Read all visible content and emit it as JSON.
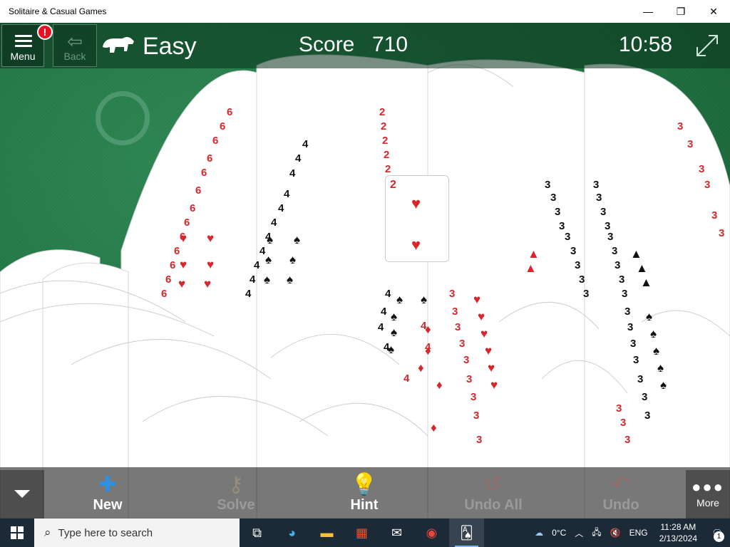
{
  "window": {
    "title": "Solitaire & Casual Games",
    "controls": {
      "minimize": "—",
      "maximize": "❐",
      "close": "✕"
    }
  },
  "game": {
    "menu_label": "Menu",
    "alert_badge": "!",
    "back_label": "Back",
    "back_icon": "arrow-left-icon",
    "difficulty_icon": "polar-bear-icon",
    "difficulty": "Easy",
    "score_label": "Score",
    "score_value": "710",
    "timer": "10:58",
    "fullscreen_icon": "expand-arrows-icon",
    "colors": {
      "felt": "#1f7040",
      "red_suit": "#d9262b",
      "black_suit": "#111111"
    }
  },
  "toolbar": {
    "expand_icon": "chevron-down-icon",
    "new_label": "New",
    "solve_label": "Solve",
    "hint_label": "Hint",
    "undo_all_label": "Undo All",
    "undo_label": "Undo",
    "more_label": "More",
    "more_icon": "more-dots-icon"
  },
  "taskbar": {
    "search_placeholder": "Type here to search",
    "weather": "0°C",
    "language": "ENG",
    "time": "11:28 AM",
    "date": "2/13/2024",
    "notification_count": "1",
    "pinned": [
      "task-view-icon",
      "edge-icon",
      "file-explorer-icon",
      "store-icon",
      "mail-icon",
      "chrome-icon",
      "solitaire-icon"
    ]
  }
}
